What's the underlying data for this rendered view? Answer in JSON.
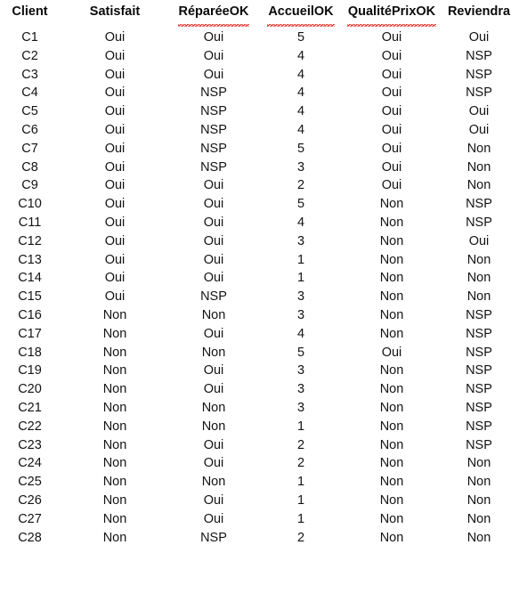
{
  "table": {
    "columns": [
      {
        "key": "client",
        "label": "Client",
        "spellcheck_flagged": false
      },
      {
        "key": "satisfait",
        "label": "Satisfait",
        "spellcheck_flagged": false
      },
      {
        "key": "repareeok",
        "label": "RéparéeOK",
        "spellcheck_flagged": true
      },
      {
        "key": "accueilok",
        "label": "AccueilOK",
        "spellcheck_flagged": true
      },
      {
        "key": "qualiteprixok",
        "label": "QualitéPrixOK",
        "spellcheck_flagged": true
      },
      {
        "key": "reviendra",
        "label": "Reviendra",
        "spellcheck_flagged": false
      }
    ],
    "rows": [
      [
        "C1",
        "Oui",
        "Oui",
        "5",
        "Oui",
        "Oui"
      ],
      [
        "C2",
        "Oui",
        "Oui",
        "4",
        "Oui",
        "NSP"
      ],
      [
        "C3",
        "Oui",
        "Oui",
        "4",
        "Oui",
        "NSP"
      ],
      [
        "C4",
        "Oui",
        "NSP",
        "4",
        "Oui",
        "NSP"
      ],
      [
        "C5",
        "Oui",
        "NSP",
        "4",
        "Oui",
        "Oui"
      ],
      [
        "C6",
        "Oui",
        "NSP",
        "4",
        "Oui",
        "Oui"
      ],
      [
        "C7",
        "Oui",
        "NSP",
        "5",
        "Oui",
        "Non"
      ],
      [
        "C8",
        "Oui",
        "NSP",
        "3",
        "Oui",
        "Non"
      ],
      [
        "C9",
        "Oui",
        "Oui",
        "2",
        "Oui",
        "Non"
      ],
      [
        "C10",
        "Oui",
        "Oui",
        "5",
        "Non",
        "NSP"
      ],
      [
        "C11",
        "Oui",
        "Oui",
        "4",
        "Non",
        "NSP"
      ],
      [
        "C12",
        "Oui",
        "Oui",
        "3",
        "Non",
        "Oui"
      ],
      [
        "C13",
        "Oui",
        "Oui",
        "1",
        "Non",
        "Non"
      ],
      [
        "C14",
        "Oui",
        "Oui",
        "1",
        "Non",
        "Non"
      ],
      [
        "C15",
        "Oui",
        "NSP",
        "3",
        "Non",
        "Non"
      ],
      [
        "C16",
        "Non",
        "Non",
        "3",
        "Non",
        "NSP"
      ],
      [
        "C17",
        "Non",
        "Oui",
        "4",
        "Non",
        "NSP"
      ],
      [
        "C18",
        "Non",
        "Non",
        "5",
        "Oui",
        "NSP"
      ],
      [
        "C19",
        "Non",
        "Oui",
        "3",
        "Non",
        "NSP"
      ],
      [
        "C20",
        "Non",
        "Oui",
        "3",
        "Non",
        "NSP"
      ],
      [
        "C21",
        "Non",
        "Non",
        "3",
        "Non",
        "NSP"
      ],
      [
        "C22",
        "Non",
        "Non",
        "1",
        "Non",
        "NSP"
      ],
      [
        "C23",
        "Non",
        "Oui",
        "2",
        "Non",
        "NSP"
      ],
      [
        "C24",
        "Non",
        "Oui",
        "2",
        "Non",
        "Non"
      ],
      [
        "C25",
        "Non",
        "Non",
        "1",
        "Non",
        "Non"
      ],
      [
        "C26",
        "Non",
        "Oui",
        "1",
        "Non",
        "Non"
      ],
      [
        "C27",
        "Non",
        "Oui",
        "1",
        "Non",
        "Non"
      ],
      [
        "C28",
        "Non",
        "NSP",
        "2",
        "Non",
        "Non"
      ]
    ],
    "row_count": 28,
    "column_count": 6
  },
  "colors": {
    "text": "#131313",
    "header_text": "#0a0a0a",
    "background": "#ffffff",
    "spellcheck_underline": "#e0201a"
  }
}
